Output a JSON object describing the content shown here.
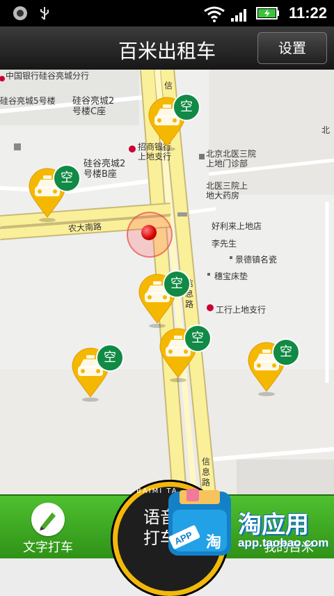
{
  "status_bar": {
    "time": "11:22"
  },
  "header": {
    "title": "百米出租车",
    "settings_label": "设置"
  },
  "map": {
    "labels": {
      "boc": "中国银行硅谷亮城分行",
      "bldg5": "硅谷亮城5号楼",
      "bldg2c_1": "硅谷亮城2",
      "bldg2c_2": "号楼C座",
      "bldg2b_1": "硅谷亮城2",
      "bldg2b_2": "号楼B座",
      "cmb_1": "招商银行",
      "cmb_2": "上地支行",
      "hosp_1": "北京北医三院",
      "hosp_2": "上地门诊部",
      "pharm_1": "北医三院上",
      "pharm_2": "地大药房",
      "hll": "好利来上地店",
      "mr_li": "李先生",
      "jdz": "景德镇名瓷",
      "wbcd": "穗宝床垫",
      "icbc": "工行上地支行",
      "north": "北",
      "road_nongda": "农大南路",
      "road_xinxi1": "信息",
      "road_xinxi2": "信息路",
      "road_xinxi3": "信息路",
      "road_xinxi4": "信"
    },
    "taxi_badge": "空",
    "taxi_count": 6
  },
  "bottom_bar": {
    "text_order_label": "文字打车",
    "voice_ring_text": "BAIMI TA",
    "voice_label": "语音打车",
    "my_label": "我的百米"
  },
  "watermark": {
    "brand": "淘应用",
    "url": "app.taobao.com",
    "app_badge": "APP",
    "tao_char": "淘"
  },
  "colors": {
    "accent_green": "#3aa820",
    "taxi_yellow": "#f5b800",
    "badge_green": "#108a45"
  }
}
